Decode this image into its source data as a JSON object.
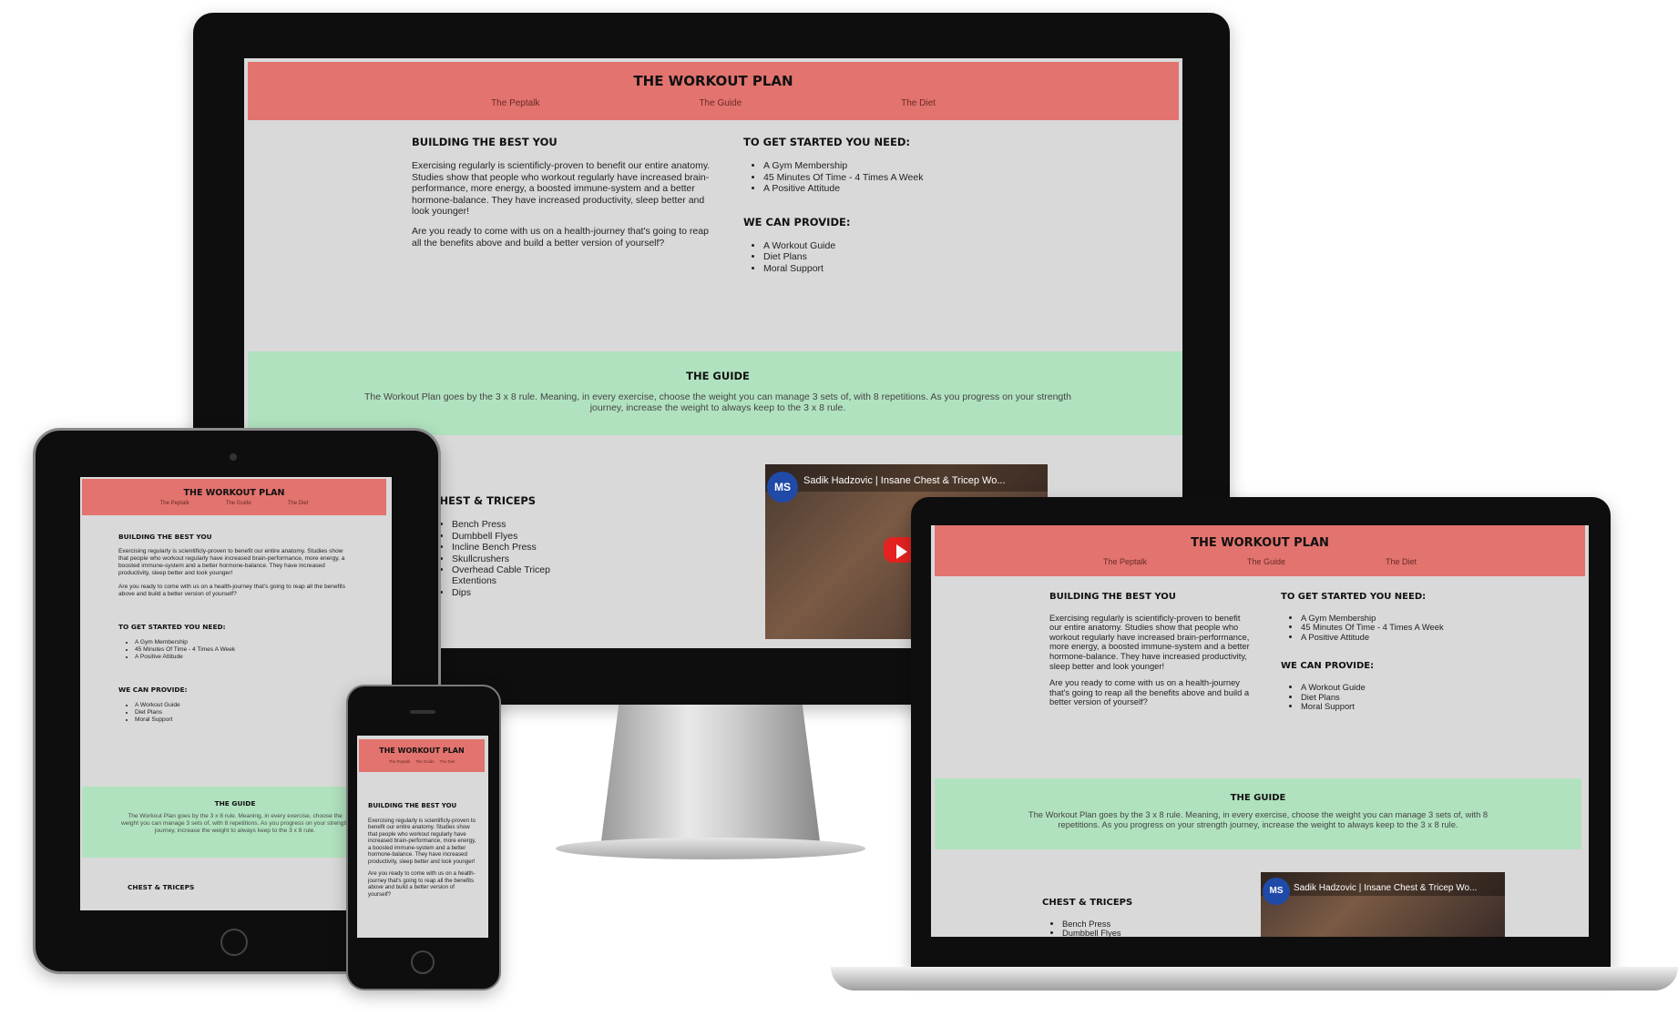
{
  "site": {
    "title": "THE WORKOUT PLAN",
    "nav": [
      "The Peptalk",
      "The Guide",
      "The Diet"
    ]
  },
  "intro": {
    "heading": "BUILDING THE BEST YOU",
    "p1": "Exercising regularly is scientificly-proven to benefit our entire anatomy. Studies show that people who workout regularly have increased brain-performance, more energy, a boosted immune-system and a better hormone-balance. They have increased productivity, sleep better and look younger!",
    "p2": "Are you ready to come with us on a health-journey that's going to reap all the benefits above and build a better version of yourself?"
  },
  "needs": {
    "heading": "TO GET STARTED YOU NEED:",
    "items": [
      "A Gym Membership",
      "45 Minutes Of Time - 4 Times A Week",
      "A Positive Attitude"
    ]
  },
  "provide": {
    "heading": "WE CAN PROVIDE:",
    "items": [
      "A Workout Guide",
      "Diet Plans",
      "Moral Support"
    ]
  },
  "guide": {
    "heading": "THE GUIDE",
    "text": "The Workout Plan goes by the 3 x 8 rule. Meaning, in every exercise, choose the weight you can manage 3 sets of, with 8 repetitions. As you progress on your strength journey, increase the weight to always keep to the 3 x 8 rule."
  },
  "chest": {
    "heading": "CHEST & TRICEPS",
    "items": [
      "Bench Press",
      "Dumbbell Flyes",
      "Incline Bench Press",
      "Skullcrushers",
      "Overhead Cable Tricep Extentions",
      "Dips"
    ],
    "laptop_partial": [
      "Bench Press",
      "Dumbbell Flyes"
    ]
  },
  "video": {
    "title": "Sadik Hadzovic | Insane Chest & Tricep Wo...",
    "logo": "MS"
  },
  "colors": {
    "header": "#e2736e",
    "guide": "#b1e2bf",
    "body": "#d9d9d9"
  }
}
